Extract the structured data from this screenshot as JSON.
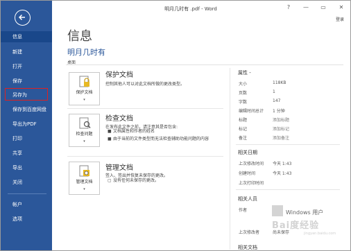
{
  "window": {
    "title": "明月几时有 .pdf - Word",
    "help": "?",
    "minimize": "—",
    "restore": "▭",
    "close": "✕",
    "sign_in": "登录"
  },
  "sidebar": {
    "items": [
      {
        "label": "信息"
      },
      {
        "label": "新建"
      },
      {
        "label": "打开"
      },
      {
        "label": "保存"
      },
      {
        "label": "另存为"
      },
      {
        "label": "保存到百度网盘"
      },
      {
        "label": "导出为PDF"
      },
      {
        "label": "打印"
      },
      {
        "label": "共享"
      },
      {
        "label": "导出"
      },
      {
        "label": "关闭"
      },
      {
        "label": "帐户"
      },
      {
        "label": "选项"
      }
    ]
  },
  "main": {
    "title": "信息",
    "doc_name": "明月几时有",
    "doc_location": "桌面",
    "protect": {
      "button": "保护文档",
      "title": "保护文档",
      "desc": "控制其他人可以对此文档所做的更改类型。"
    },
    "inspect": {
      "button": "检查问题",
      "title": "检查文档",
      "desc": "在发布此文件之前，请注意其是否包含:",
      "bullets": [
        "文档属性和作者的姓名",
        "由于当前的文件类型而无法检查辅助功能问题的内容"
      ]
    },
    "versions": {
      "button": "管理文档",
      "title": "管理文档",
      "desc": "签入、签出并恢复未保存的更改。",
      "note": "没有任何未保存的更改。"
    }
  },
  "properties": {
    "header": "属性 -",
    "rows": [
      {
        "key": "大小",
        "value": "118KB"
      },
      {
        "key": "页数",
        "value": "1"
      },
      {
        "key": "字数",
        "value": "147"
      },
      {
        "key": "编辑时间总计",
        "value": "1 分钟"
      },
      {
        "key": "标题",
        "value": "添加标题"
      },
      {
        "key": "标记",
        "value": "添加标记"
      },
      {
        "key": "备注",
        "value": "添加备注"
      }
    ],
    "dates_header": "相关日期",
    "dates": [
      {
        "key": "上次修改时间",
        "value": "今天 1:43"
      },
      {
        "key": "创建时间",
        "value": "今天 1:43"
      },
      {
        "key": "上次打印时间",
        "value": ""
      }
    ],
    "people_header": "相关人员",
    "author_label": "作者",
    "author_name": "Windows 用户",
    "modified_by_label": "上次修改者",
    "modified_by": "尚未保存",
    "docs_header": "相关文档"
  },
  "watermark": {
    "text": "Bai度经验",
    "sub": "jingyan.baidu.com"
  },
  "colors": {
    "sidebar": "#2b579a",
    "accent": "#2b579a",
    "highlight": "#e02020"
  }
}
